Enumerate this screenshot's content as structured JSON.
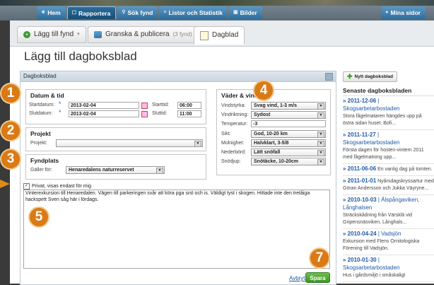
{
  "nav": {
    "items": [
      {
        "label": "Hem",
        "icon": "home-icon"
      },
      {
        "label": "Rapportera",
        "icon": "report-icon"
      },
      {
        "label": "Sök fynd",
        "icon": "search-icon"
      },
      {
        "label": "Listor och Statistik",
        "icon": "list-icon"
      },
      {
        "label": "Bilder",
        "icon": "image-icon"
      }
    ],
    "mina_sidor": "Mina sidor"
  },
  "subtabs": {
    "add": "Lägg till fynd",
    "review": "Granska & publicera",
    "review_count": "(3 fynd)",
    "diary": "Dagblad"
  },
  "page_title": "Lägg till dagboksblad",
  "panel_title": "Dagboksblad",
  "datum": {
    "title": "Datum & tid",
    "start_date_label": "Startdatum:",
    "start_date": "2013-02-04",
    "end_date_label": "Slutdatum:",
    "end_date": "2013-02-04",
    "start_time_label": "Starttid:",
    "start_time": "06:00",
    "end_time_label": "Sluttid:",
    "end_time": "11:00"
  },
  "projekt": {
    "title": "Projekt",
    "label": "Projekt:",
    "value": ""
  },
  "fyndplats": {
    "title": "Fyndplats",
    "label": "Gäller för:",
    "value": "Henaredalens naturreservet"
  },
  "vader": {
    "title": "Väder & vind",
    "rows": [
      {
        "label": "Vindstyrka:",
        "value": "Svag vind, 1-3 m/s"
      },
      {
        "label": "Vindriktning:",
        "value": "Sydost"
      },
      {
        "label": "Temperatur:",
        "value": "-3"
      },
      {
        "label": "Sikt:",
        "value": "God, 10-20 km"
      },
      {
        "label": "Molnighet:",
        "value": "Halvklart, 3-5/8"
      },
      {
        "label": "Nederbörd:",
        "value": "Lätt snöfall"
      },
      {
        "label": "Snödjup:",
        "value": "Snötäcke, 10-20cm"
      }
    ]
  },
  "private_label": "Privat, visas endast för mig",
  "description": "Vinterexkursion till Henaredalen. Vägen till parkeringen svår att köra pga snö och is. Väldigt tyst i skogen. Hittade inte den tretåiga hackspett Sven såg här i lördags.",
  "buttons": {
    "cancel": "Avbryt",
    "save": "Spara"
  },
  "badges": {
    "b1": "1",
    "b2": "2",
    "b3": "3",
    "b4": "4",
    "b5": "5",
    "b7": "7"
  },
  "sidebar": {
    "new_button": "Nytt dagboksblad",
    "title": "Senaste dagboksbladen",
    "items": [
      {
        "date": "» 2011-12-06",
        "place": "Skogsarbetarbostaden",
        "text": "Stora fågelmataren hängdes upp på östra sidan huset. Bofi..."
      },
      {
        "date": "» 2011-11-27",
        "place": "Skogsarbetarbostaden",
        "text": "Första dagen för hosten-vintern 2011 med fågelmatning upp..."
      },
      {
        "date": "» 2011-06-06",
        "place": "",
        "text": "En vanlig dag på tomten."
      },
      {
        "date": "» 2011-01-01",
        "place": "",
        "text": "Nyårsdagskryssartur med Göran Andersson och Jukka Väyryne..."
      },
      {
        "date": "» 2010-10-03",
        "place": "Älspångaviken, Långhalsen",
        "text": "Sträckskådning från Värsklä vid Gripensnäsviken, Långhals..."
      },
      {
        "date": "» 2010-04-24",
        "place": "Vadsjön",
        "text": "Exkursion med Flens Ornitologiska Förening till Vadsjön."
      },
      {
        "date": "» 2010-01-30",
        "place": "Skogsarbetarbostaden",
        "text": "Hus i gårdsmiljö i småskaligt"
      }
    ]
  }
}
